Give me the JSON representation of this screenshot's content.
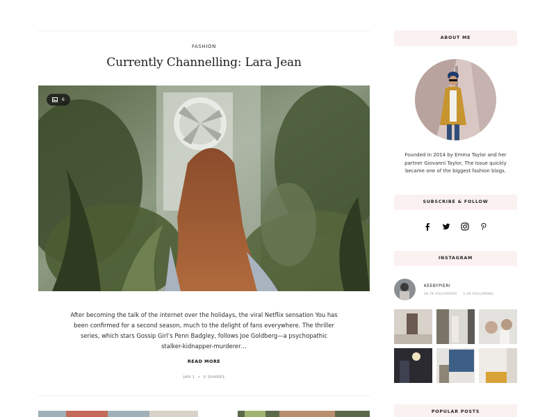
{
  "post": {
    "category": "FASHION",
    "title": "Currently Channelling: Lara Jean",
    "gallery_count": "6",
    "excerpt": "After becoming the talk of the internet over the holidays, the viral Netflix sensation You has been confirmed for a second season, much to the delight of fans everywhere. The thriller series, which stars Gossip Girl’s Penn Badgley, follows Joe Goldberg—a psychopathic stalker-kidnapper-murderer…",
    "read_more": "READ MORE",
    "date": "JAN 1",
    "separator": "•",
    "shares": "0 SHARES"
  },
  "sidebar": {
    "about": {
      "title": "ABOUT ME",
      "text": "Founded in 2014 by Emma Taylor and her partner Giovanni Taylor, The Issue quickly became one of the biggest fashion blogs."
    },
    "subscribe": {
      "title": "SUBSCRIBE & FOLLOW",
      "icons": [
        "facebook-icon",
        "twitter-icon",
        "instagram-icon",
        "pinterest-icon"
      ]
    },
    "instagram": {
      "title": "INSTAGRAM",
      "username": "KEEBYPIERI",
      "followers": "49.7K FOLLOWERS",
      "following": "1.4K FOLLOWING"
    },
    "popular": {
      "title": "POPULAR POSTS"
    }
  },
  "colors": {
    "widget_bg": "#fbf1f1",
    "rule": "#f0eeee",
    "text": "#222222",
    "muted": "#888888"
  }
}
